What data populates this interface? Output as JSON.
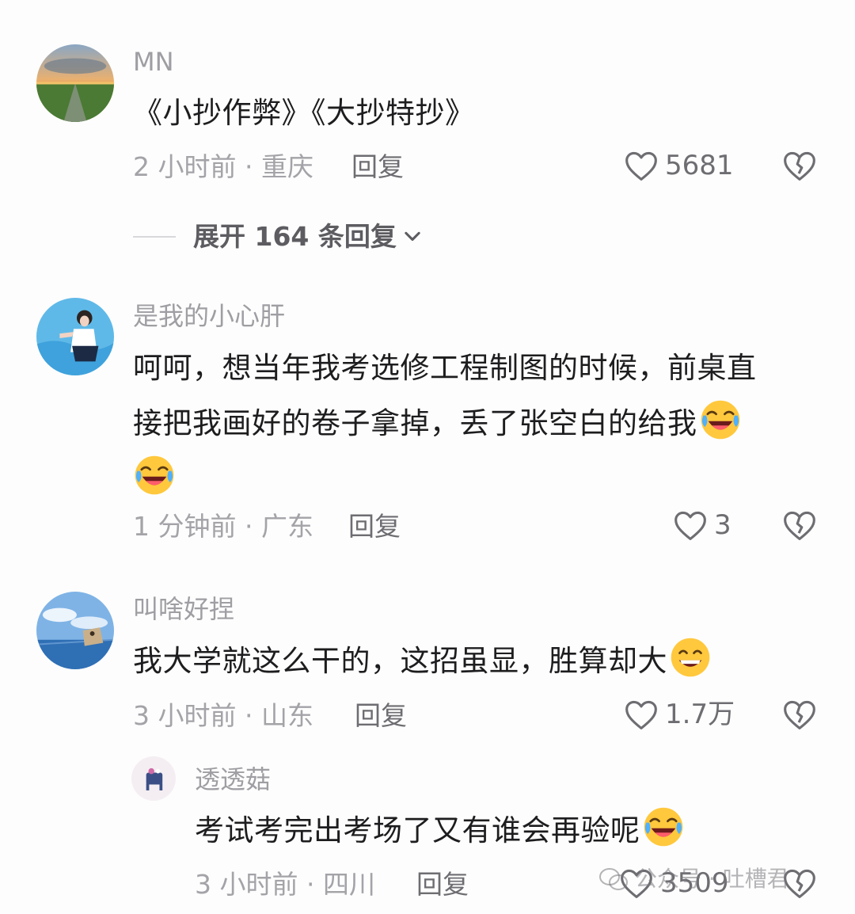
{
  "comments": [
    {
      "username": "MN",
      "content": "《小抄作弊》《大抄特抄》",
      "time_location": "2 小时前 · 重庆",
      "reply_label": "回复",
      "likes": "5681"
    },
    {
      "username": "是我的小心肝",
      "content_line1": "呵呵，想当年我考选修工程制图的时候，前桌直",
      "content_line2": "接把我画好的卷子拿掉，丢了张空白的给我",
      "time_location": "1 分钟前 · 广东",
      "reply_label": "回复",
      "likes": "3"
    },
    {
      "username": "叫啥好捏",
      "content": "我大学就这么干的，这招虽显，胜算却大",
      "time_location": "3 小时前 · 山东",
      "reply_label": "回复",
      "likes": "1.7万"
    },
    {
      "username": "透透菇",
      "content": "考试考完出考场了又有谁会再验呢",
      "time_location": "3 小时前 · 四川",
      "reply_label": "回复",
      "likes": "3509"
    }
  ],
  "expand_replies": {
    "label": "展开 164 条回复"
  },
  "watermark": {
    "text": "公众号 · 吐槽君"
  },
  "icons": {
    "like": "heart-outline-icon",
    "dislike": "broken-heart-icon",
    "expand": "chevron-down-icon",
    "emoji_laugh_cry": "laughing-crying-emoji",
    "emoji_grin": "grinning-emoji",
    "watermark": "wechat-icon"
  },
  "colors": {
    "background": "#fdfdfd",
    "text_primary": "#1d1d1f",
    "text_secondary": "#a3a3a8",
    "icon": "#6d6d72"
  }
}
